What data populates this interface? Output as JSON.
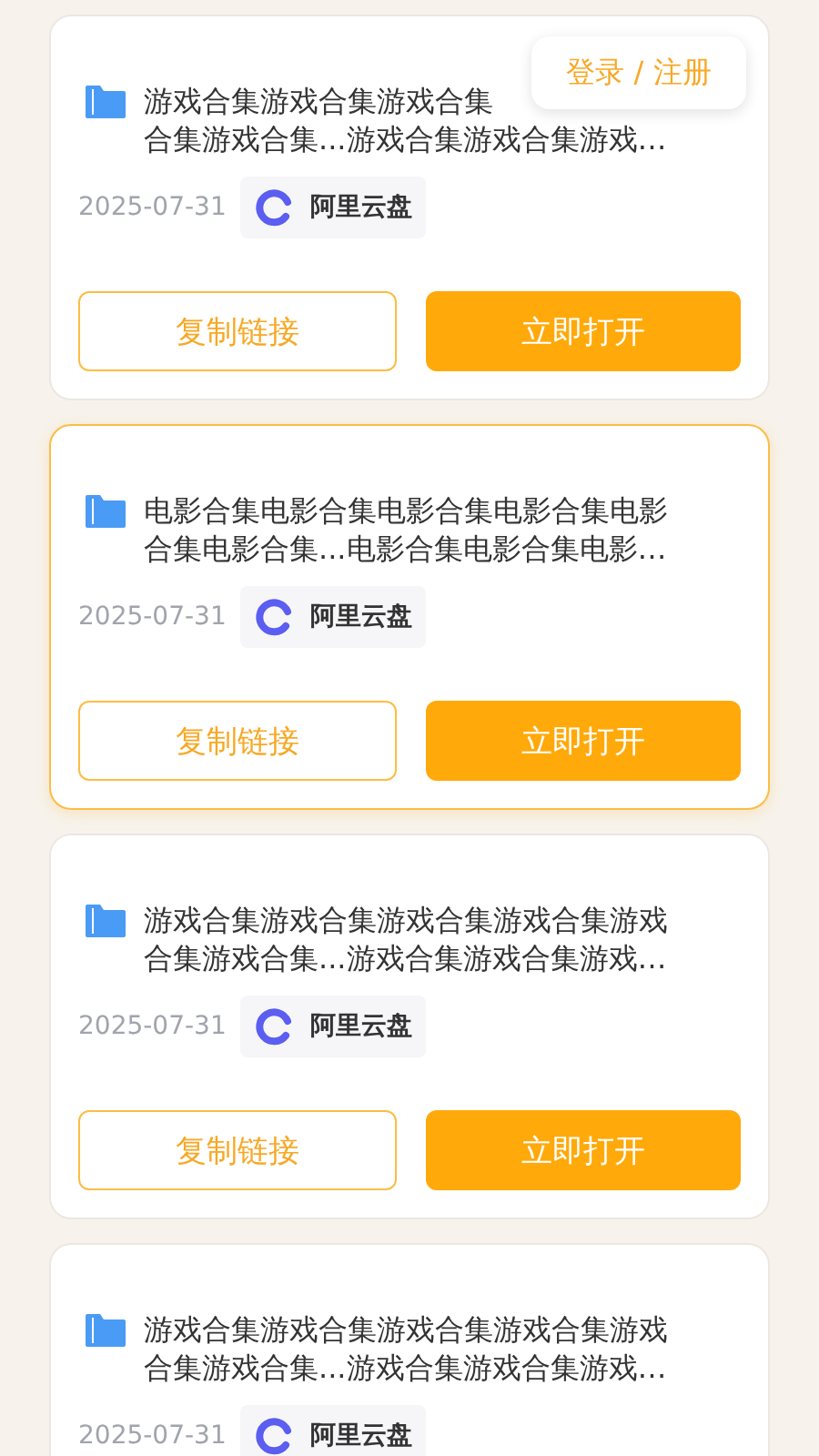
{
  "login_button": {
    "label": "登录 / 注册"
  },
  "cards": [
    {
      "selected": false,
      "title_lines": [
        "游戏合集游戏合集游戏合集",
        "合集游戏合集...游戏合集游戏合集游戏…"
      ],
      "date": "2025-07-31",
      "drive": "阿里云盘",
      "copy_button": "复制链接",
      "open_button": "立即打开"
    },
    {
      "selected": true,
      "title_lines": [
        "电影合集电影合集电影合集电影合集电影",
        "合集电影合集...电影合集电影合集电影…"
      ],
      "date": "2025-07-31",
      "drive": "阿里云盘",
      "copy_button": "复制链接",
      "open_button": "立即打开"
    },
    {
      "selected": false,
      "title_lines": [
        "游戏合集游戏合集游戏合集游戏合集游戏",
        "合集游戏合集...游戏合集游戏合集游戏…"
      ],
      "date": "2025-07-31",
      "drive": "阿里云盘",
      "copy_button": "复制链接",
      "open_button": "立即打开"
    },
    {
      "selected": false,
      "title_lines": [
        "游戏合集游戏合集游戏合集游戏合集游戏",
        "合集游戏合集...游戏合集游戏合集游戏…"
      ],
      "date": "2025-07-31",
      "drive": "阿里云盘"
    }
  ]
}
